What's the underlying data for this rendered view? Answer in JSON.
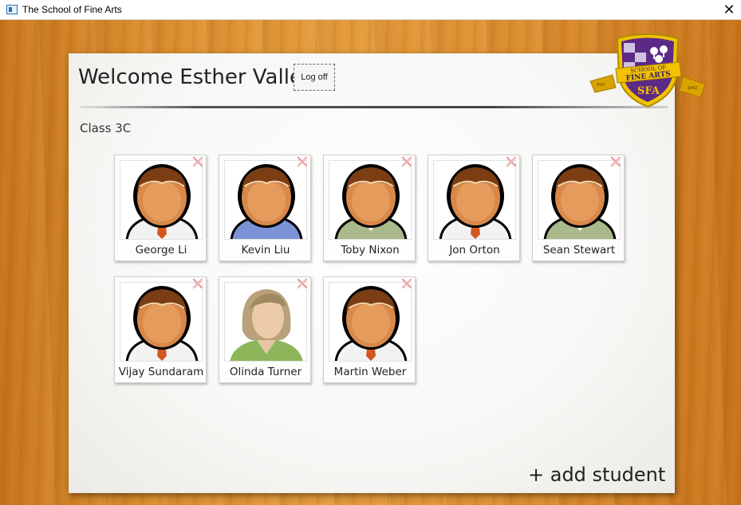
{
  "window": {
    "title": "The School of Fine Arts",
    "close_glyph": "✕"
  },
  "header": {
    "welcome": "Welcome Esther Valle!",
    "logoff_label": "Log off"
  },
  "crest": {
    "line1": "SCHOOL OF",
    "line2": "FINE ARTS",
    "monogram": "SFA",
    "est_left": "EST.",
    "est_right": "1942"
  },
  "class_name": "Class 3C",
  "students": [
    {
      "name": "George Li",
      "avatar": "male-white-shirt-icon"
    },
    {
      "name": "Kevin Liu",
      "avatar": "male-blue-sweater-icon"
    },
    {
      "name": "Toby Nixon",
      "avatar": "male-green-shirt-icon"
    },
    {
      "name": "Jon Orton",
      "avatar": "male-white-shirt-icon"
    },
    {
      "name": "Sean Stewart",
      "avatar": "male-green-shirt-icon"
    },
    {
      "name": "Vijay Sundaram",
      "avatar": "male-white-shirt-icon"
    },
    {
      "name": "Olinda Turner",
      "avatar": "female-green-top-icon"
    },
    {
      "name": "Martin Weber",
      "avatar": "male-white-shirt-icon"
    }
  ],
  "add_student_label": "+ add student",
  "colors": {
    "wood": "#d98c2c",
    "crest_purple": "#5b2a86",
    "crest_gold": "#f2c200",
    "remove_mark": "#e7a3a3"
  }
}
